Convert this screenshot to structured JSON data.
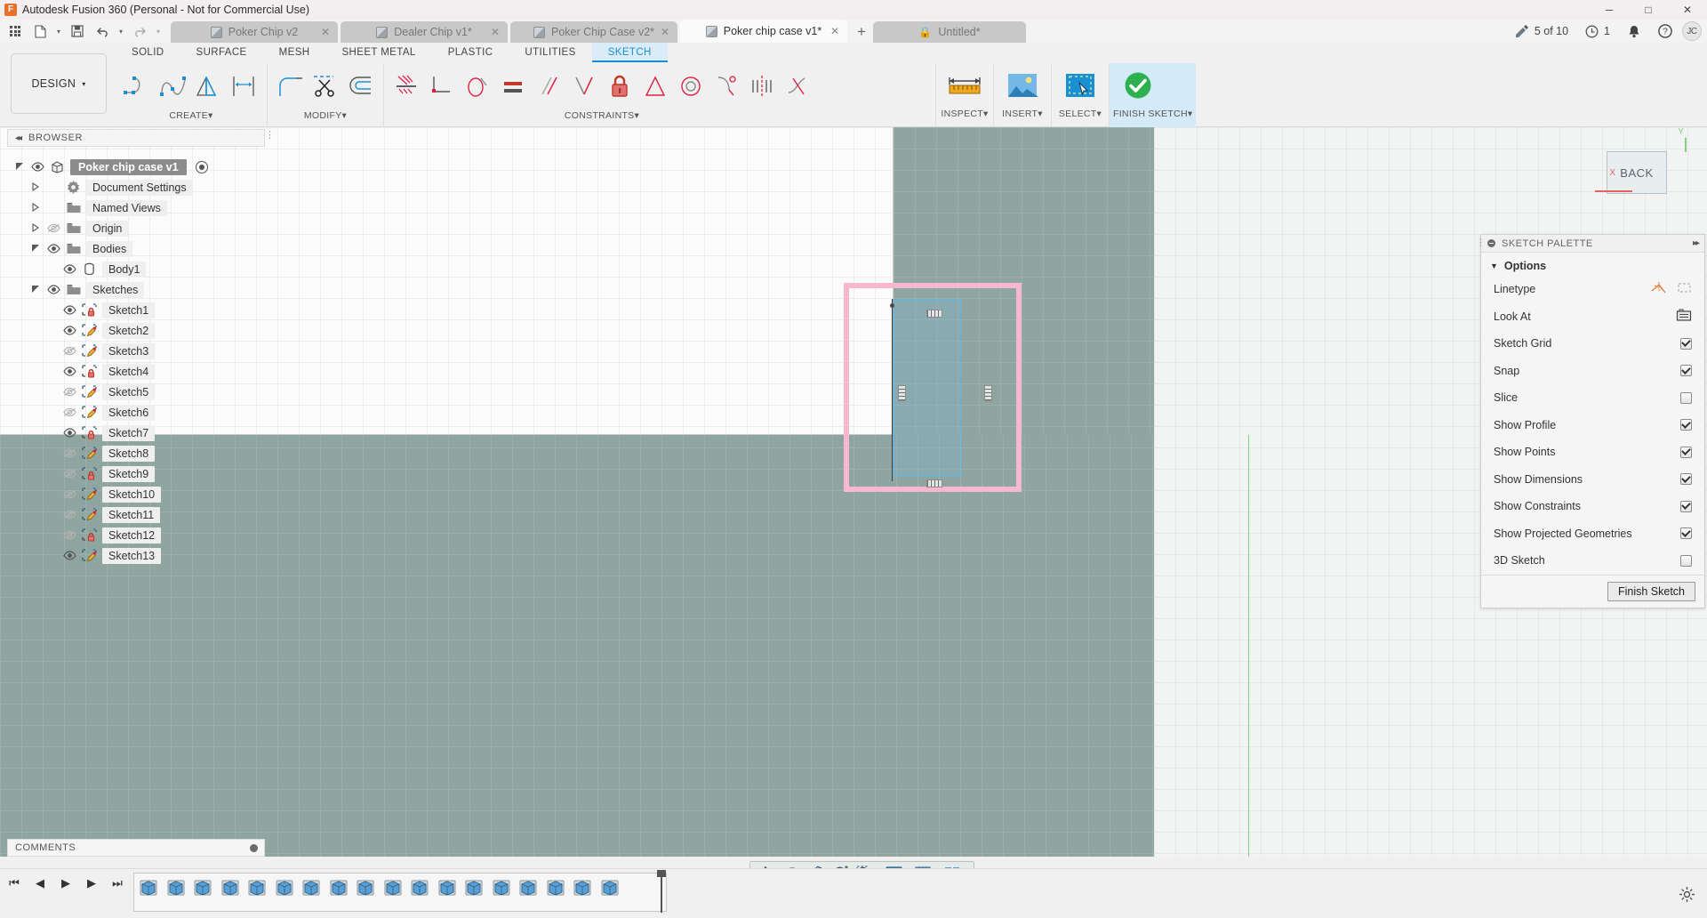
{
  "window": {
    "title": "Autodesk Fusion 360 (Personal - Not for Commercial Use)",
    "app_icon": "fusion-logo-icon",
    "minimize": "─",
    "maximize": "□",
    "close": "✕"
  },
  "quick_access": {
    "grid_label": "app-grid",
    "new_label": "new-file",
    "save_label": "save",
    "undo_label": "undo",
    "redo_label": "redo",
    "caret": "▾"
  },
  "tabs": {
    "items": [
      {
        "label": "Poker Chip v2",
        "icon": "cube-icon",
        "active": false,
        "closable": true
      },
      {
        "label": "Dealer Chip v1*",
        "icon": "cube-icon",
        "active": false,
        "closable": true
      },
      {
        "label": "Poker Chip Case v2*",
        "icon": "cube-icon",
        "active": false,
        "closable": true
      },
      {
        "label": "Poker chip case v1*",
        "icon": "cube-icon",
        "active": true,
        "closable": true
      },
      {
        "label": "Untitled*",
        "icon": "lock-icon",
        "active": false,
        "closable": false
      }
    ],
    "close_glyph": "✕",
    "add_glyph": "+"
  },
  "tabbar_right": {
    "jobs": "5 of 10",
    "jobs_icon": "job-status-icon",
    "recent": "1",
    "recent_icon": "clock-icon",
    "notifications_icon": "bell-icon",
    "help_icon": "question-mark-icon",
    "avatar_initials": "JC"
  },
  "ribbon": {
    "design_menu": "DESIGN",
    "caret": "▾",
    "workspace_tabs": [
      {
        "label": "SOLID",
        "active": false
      },
      {
        "label": "SURFACE",
        "active": false
      },
      {
        "label": "MESH",
        "active": false
      },
      {
        "label": "SHEET METAL",
        "active": false
      },
      {
        "label": "PLASTIC",
        "active": false
      },
      {
        "label": "UTILITIES",
        "active": false
      },
      {
        "label": "SKETCH",
        "active": true
      }
    ],
    "panels": [
      {
        "label": "CREATE",
        "has_caret": true,
        "tools": [
          "line-icon",
          "spline-icon",
          "triangle-shape-icon",
          "dimension-icon"
        ]
      },
      {
        "label": "MODIFY",
        "has_caret": true,
        "tools": [
          "fillet-icon",
          "trim-scissors-icon",
          "offset-icon"
        ]
      },
      {
        "label": "CONSTRAINTS",
        "has_caret": true,
        "tools": [
          "coincident-icon",
          "collinear-icon",
          "tangent-icon",
          "equal-icon",
          "parallel-icon",
          "perpendicular-icon",
          "fix-lock-icon",
          "midpoint-icon",
          "concentric-icon",
          "curvature-icon",
          "symmetry-icon",
          "smooth-icon"
        ]
      }
    ],
    "right_panels": [
      {
        "label": "INSPECT",
        "icon": "measure-ruler-icon",
        "has_caret": true,
        "active": false
      },
      {
        "label": "INSERT",
        "icon": "insert-image-icon",
        "has_caret": true,
        "active": false
      },
      {
        "label": "SELECT",
        "icon": "select-cursor-icon",
        "has_caret": true,
        "active": false
      },
      {
        "label": "FINISH SKETCH",
        "icon": "green-check-icon",
        "has_caret": true,
        "active": true
      }
    ]
  },
  "browser": {
    "title": "BROWSER",
    "collapse_glyph": "◂◂",
    "nodes": [
      {
        "label": "Poker chip case v1",
        "indent": 0,
        "twist": "expanded",
        "eye": "visible",
        "icon": "component-cube-icon",
        "selected": true,
        "radio": true
      },
      {
        "label": "Document Settings",
        "indent": 1,
        "twist": "collapsed",
        "eye": "none",
        "icon": "gear-icon",
        "selected": false,
        "radio": false
      },
      {
        "label": "Named Views",
        "indent": 1,
        "twist": "collapsed",
        "eye": "none",
        "icon": "folder-icon",
        "selected": false,
        "radio": false
      },
      {
        "label": "Origin",
        "indent": 1,
        "twist": "collapsed",
        "eye": "hidden",
        "icon": "folder-icon",
        "selected": false,
        "radio": false
      },
      {
        "label": "Bodies",
        "indent": 1,
        "twist": "expanded",
        "eye": "visible",
        "icon": "folder-icon",
        "selected": false,
        "radio": false
      },
      {
        "label": "Body1",
        "indent": 2,
        "twist": "none",
        "eye": "visible",
        "icon": "body-icon",
        "selected": false,
        "radio": false
      },
      {
        "label": "Sketches",
        "indent": 1,
        "twist": "expanded",
        "eye": "visible",
        "icon": "folder-icon",
        "selected": false,
        "radio": false
      },
      {
        "label": "Sketch1",
        "indent": 2,
        "twist": "none",
        "eye": "visible",
        "icon": "sketch-locked-icon",
        "selected": false,
        "radio": false
      },
      {
        "label": "Sketch2",
        "indent": 2,
        "twist": "none",
        "eye": "visible",
        "icon": "sketch-edit-icon",
        "selected": false,
        "radio": false
      },
      {
        "label": "Sketch3",
        "indent": 2,
        "twist": "none",
        "eye": "hidden",
        "icon": "sketch-edit-icon",
        "selected": false,
        "radio": false
      },
      {
        "label": "Sketch4",
        "indent": 2,
        "twist": "none",
        "eye": "visible",
        "icon": "sketch-locked-icon",
        "selected": false,
        "radio": false
      },
      {
        "label": "Sketch5",
        "indent": 2,
        "twist": "none",
        "eye": "hidden",
        "icon": "sketch-edit-icon",
        "selected": false,
        "radio": false
      },
      {
        "label": "Sketch6",
        "indent": 2,
        "twist": "none",
        "eye": "hidden",
        "icon": "sketch-edit-icon",
        "selected": false,
        "radio": false
      },
      {
        "label": "Sketch7",
        "indent": 2,
        "twist": "none",
        "eye": "visible",
        "icon": "sketch-locked-icon",
        "selected": false,
        "radio": false
      },
      {
        "label": "Sketch8",
        "indent": 2,
        "twist": "none",
        "eye": "hidden",
        "icon": "sketch-edit-icon",
        "selected": false,
        "radio": false
      },
      {
        "label": "Sketch9",
        "indent": 2,
        "twist": "none",
        "eye": "hidden",
        "icon": "sketch-locked-icon",
        "selected": false,
        "radio": false
      },
      {
        "label": "Sketch10",
        "indent": 2,
        "twist": "none",
        "eye": "hidden",
        "icon": "sketch-edit-icon",
        "selected": false,
        "radio": false
      },
      {
        "label": "Sketch11",
        "indent": 2,
        "twist": "none",
        "eye": "hidden",
        "icon": "sketch-edit-icon",
        "selected": false,
        "radio": false
      },
      {
        "label": "Sketch12",
        "indent": 2,
        "twist": "none",
        "eye": "hidden",
        "icon": "sketch-locked-icon",
        "selected": false,
        "radio": false
      },
      {
        "label": "Sketch13",
        "indent": 2,
        "twist": "none",
        "eye": "visible",
        "icon": "sketch-edit-icon",
        "selected": false,
        "radio": false
      }
    ]
  },
  "palette": {
    "title": "SKETCH PALETTE",
    "pin_glyph": "▸▸",
    "section": "Options",
    "section_caret": "▼",
    "rows": [
      {
        "label": "Linetype",
        "control": "icons",
        "icons": [
          "construction-line-icon",
          "centerline-icon"
        ]
      },
      {
        "label": "Look At",
        "control": "icon",
        "icons": [
          "look-at-camera-icon"
        ]
      },
      {
        "label": "Sketch Grid",
        "control": "checkbox",
        "checked": true
      },
      {
        "label": "Snap",
        "control": "checkbox",
        "checked": true
      },
      {
        "label": "Slice",
        "control": "checkbox",
        "checked": false
      },
      {
        "label": "Show Profile",
        "control": "checkbox",
        "checked": true
      },
      {
        "label": "Show Points",
        "control": "checkbox",
        "checked": true
      },
      {
        "label": "Show Dimensions",
        "control": "checkbox",
        "checked": true
      },
      {
        "label": "Show Constraints",
        "control": "checkbox",
        "checked": true
      },
      {
        "label": "Show Projected Geometries",
        "control": "checkbox",
        "checked": true
      },
      {
        "label": "3D Sketch",
        "control": "checkbox",
        "checked": false
      }
    ],
    "finish_button": "Finish Sketch"
  },
  "comments": {
    "title": "COMMENTS"
  },
  "viewcube": {
    "face": "BACK",
    "axis_y": "Y",
    "axis_x": "X"
  },
  "navbar": {
    "items": [
      {
        "name": "orbit-icon",
        "caret": true
      },
      {
        "name": "look-at-icon",
        "caret": false
      },
      {
        "name": "pan-hand-icon",
        "caret": false
      },
      {
        "name": "zoom-icon",
        "caret": false
      },
      {
        "name": "zoom-window-icon",
        "caret": true
      },
      {
        "name": "display-settings-icon",
        "caret": true
      },
      {
        "name": "grid-settings-icon",
        "caret": true
      },
      {
        "name": "viewports-icon",
        "caret": true
      }
    ],
    "caret": "▾"
  },
  "timeline": {
    "first_glyph": "⏮",
    "prev_glyph": "◀",
    "play_glyph": "▶",
    "next_glyph": "▶",
    "last_glyph": "⏭",
    "feature_count": 18,
    "marker_position": "end",
    "settings_icon": "gear-icon"
  }
}
